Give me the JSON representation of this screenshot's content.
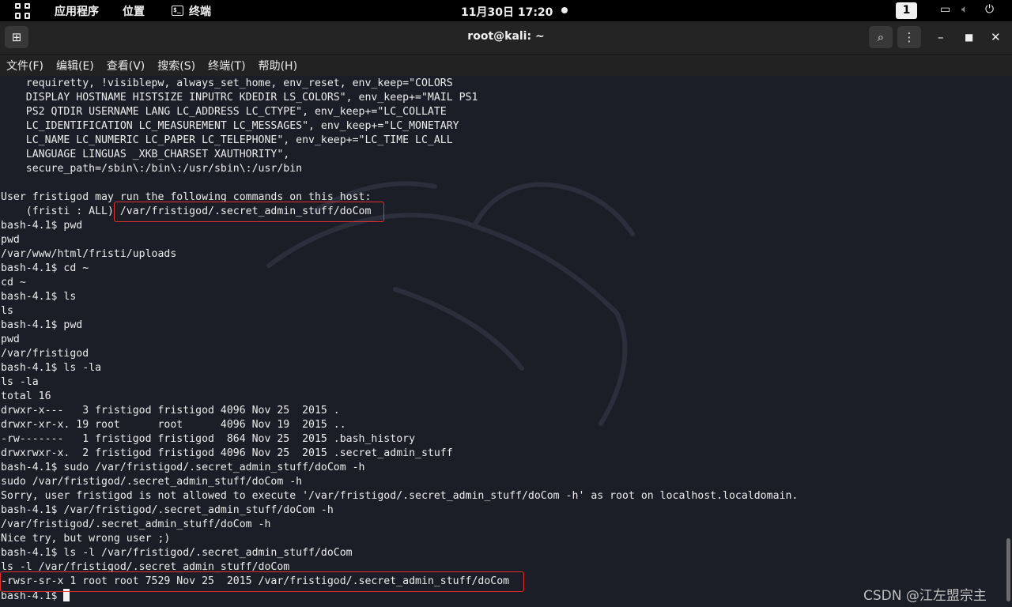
{
  "topbar": {
    "apps_label": "应用程序",
    "places_label": "位置",
    "terminal_label": "终端",
    "clock": "11月30日 17:20",
    "workspace": "1"
  },
  "window": {
    "title": "root@kali: ~"
  },
  "menu": [
    "文件(F)",
    "编辑(E)",
    "查看(V)",
    "搜索(S)",
    "终端(T)",
    "帮助(H)"
  ],
  "terminal": {
    "lines": [
      "    requiretty, !visiblepw, always_set_home, env_reset, env_keep=\"COLORS",
      "    DISPLAY HOSTNAME HISTSIZE INPUTRC KDEDIR LS_COLORS\", env_keep+=\"MAIL PS1",
      "    PS2 QTDIR USERNAME LANG LC_ADDRESS LC_CTYPE\", env_keep+=\"LC_COLLATE",
      "    LC_IDENTIFICATION LC_MEASUREMENT LC_MESSAGES\", env_keep+=\"LC_MONETARY",
      "    LC_NAME LC_NUMERIC LC_PAPER LC_TELEPHONE\", env_keep+=\"LC_TIME LC_ALL",
      "    LANGUAGE LINGUAS _XKB_CHARSET XAUTHORITY\",",
      "    secure_path=/sbin\\:/bin\\:/usr/sbin\\:/usr/bin",
      "",
      "User fristigod may run the following commands on this host:",
      "    (fristi : ALL) /var/fristigod/.secret_admin_stuff/doCom",
      "bash-4.1$ pwd",
      "pwd",
      "/var/www/html/fristi/uploads",
      "bash-4.1$ cd ~",
      "cd ~",
      "bash-4.1$ ls",
      "ls",
      "bash-4.1$ pwd",
      "pwd",
      "/var/fristigod",
      "bash-4.1$ ls -la",
      "ls -la",
      "total 16",
      "drwxr-x---   3 fristigod fristigod 4096 Nov 25  2015 .",
      "drwxr-xr-x. 19 root      root      4096 Nov 19  2015 ..",
      "-rw-------   1 fristigod fristigod  864 Nov 25  2015 .bash_history",
      "drwxrwxr-x.  2 fristigod fristigod 4096 Nov 25  2015 .secret_admin_stuff",
      "bash-4.1$ sudo /var/fristigod/.secret_admin_stuff/doCom -h",
      "sudo /var/fristigod/.secret_admin_stuff/doCom -h",
      "Sorry, user fristigod is not allowed to execute '/var/fristigod/.secret_admin_stuff/doCom -h' as root on localhost.localdomain.",
      "bash-4.1$ /var/fristigod/.secret_admin_stuff/doCom -h",
      "/var/fristigod/.secret_admin_stuff/doCom -h",
      "Nice try, but wrong user ;)",
      "bash-4.1$ ls -l /var/fristigod/.secret_admin_stuff/doCom",
      "ls -l /var/fristigod/.secret_admin_stuff/doCom",
      "-rwsr-sr-x 1 root root 7529 Nov 25  2015 /var/fristigod/.secret_admin_stuff/doCom"
    ],
    "prompt": "bash-4.1$ "
  },
  "watermark": "CSDN @江左盟宗主",
  "colors": {
    "terminal_bg": "#1b1e26",
    "highlight_box": "#e03030"
  }
}
